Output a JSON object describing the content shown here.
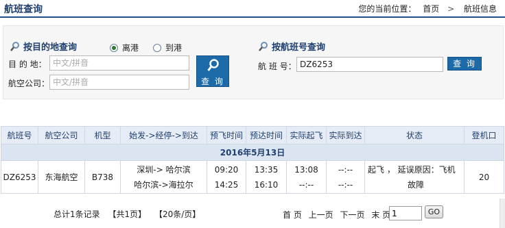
{
  "header": {
    "title": "航班查询",
    "location_label": "您的当前位置：",
    "breadcrumb_home": "首页",
    "breadcrumb_sep": ">",
    "breadcrumb_current": "航班信息"
  },
  "dest_search": {
    "title": "按目的地查询",
    "radio_depart": "离港",
    "radio_arrive": "到港",
    "selected": "离港",
    "destination_label": "目 的 地：",
    "destination_placeholder": "中文/拼音",
    "airline_label": "航空公司：",
    "airline_placeholder": "中文/拼音",
    "search_button": "查 询"
  },
  "flight_search": {
    "title": "按航班号查询",
    "flight_no_label": "航 班 号：",
    "flight_no_value": "DZ6253",
    "search_button": "查 询"
  },
  "table": {
    "headers": [
      "航班号",
      "航空公司",
      "机型",
      "始发->经停->到达",
      "预飞时间",
      "预达时间",
      "实际起飞",
      "实际到达",
      "状态",
      "登机口"
    ],
    "date_row": "2016年5月13日",
    "row": {
      "flight_no": "DZ6253",
      "airline": "东海航空",
      "aircraft": "B738",
      "route_1": "深圳-> 哈尔滨",
      "route_2": "哈尔滨->海拉尔",
      "sched_dep_1": "09:20",
      "sched_dep_2": "14:25",
      "sched_arr_1": "13:35",
      "sched_arr_2": "16:10",
      "actual_dep_1": "13:08",
      "actual_dep_2": "--:--",
      "actual_arr_1": "--:--",
      "actual_arr_2": "--:--",
      "status_1": "起飞 ， 延误原因：飞机",
      "status_2": "故障",
      "gate": "20"
    }
  },
  "pager": {
    "total": "总计1条记录",
    "pages": "【共1页】",
    "per_page": "【20条/页】",
    "first": "首 页",
    "prev": "上一页",
    "next": "下一页",
    "last": "末 页",
    "page_value": "1",
    "go": "GO"
  }
}
